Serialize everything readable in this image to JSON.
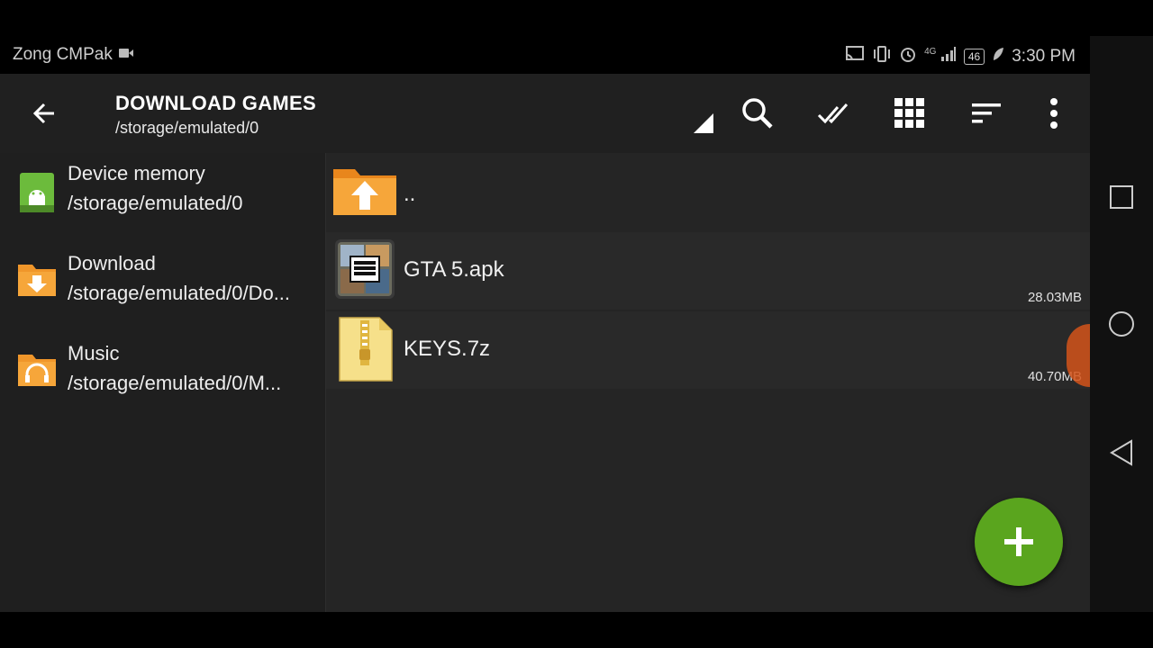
{
  "status_bar": {
    "carrier": "Zong CMPak",
    "battery": "46",
    "time": "3:30 PM",
    "signal_label": "4G"
  },
  "toolbar": {
    "title": "DOWNLOAD GAMES",
    "subtitle": "/storage/emulated/0",
    "icons": [
      "back-arrow-icon",
      "search-icon",
      "select-all-icon",
      "grid-view-icon",
      "sort-icon",
      "more-vert-icon"
    ]
  },
  "sidebar": {
    "items": [
      {
        "name": "Device memory",
        "path": "/storage/emulated/0",
        "icon": "android-storage-icon"
      },
      {
        "name": "Download",
        "path": "/storage/emulated/0/Do...",
        "icon": "download-folder-icon"
      },
      {
        "name": "Music",
        "path": "/storage/emulated/0/M...",
        "icon": "music-folder-icon"
      }
    ]
  },
  "files": [
    {
      "name": "..",
      "size": "",
      "icon": "parent-folder-icon"
    },
    {
      "name": "GTA 5.apk",
      "size": "28.03MB",
      "icon": "apk-thumbnail-icon"
    },
    {
      "name": "KEYS.7z",
      "size": "40.70MB",
      "icon": "archive-file-icon"
    }
  ],
  "colors": {
    "toolbar_bg": "#202020",
    "fab": "#5aa51e",
    "folder_orange": "#f0962a",
    "android_green": "#7bc043"
  }
}
